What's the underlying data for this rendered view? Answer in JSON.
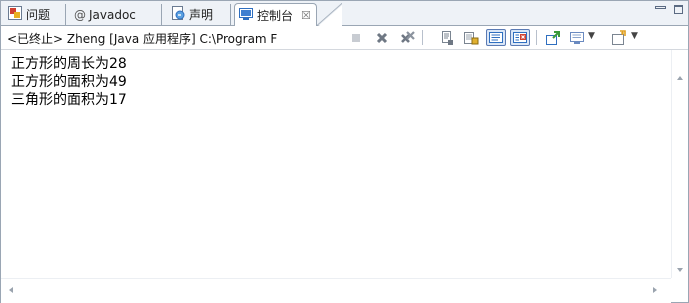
{
  "tabs": [
    {
      "label": "问题",
      "icon": "problems-icon"
    },
    {
      "label": "Javadoc",
      "icon": "at-sign-icon",
      "prefix": "@"
    },
    {
      "label": "声明",
      "icon": "declaration-icon"
    },
    {
      "label": "控制台",
      "icon": "console-icon",
      "active": true,
      "close": "☒"
    }
  ],
  "toolbar": {
    "description": "<已终止> Zheng [Java 应用程序] C:\\Program F",
    "buttons": [
      {
        "name": "terminate-icon"
      },
      {
        "name": "remove-launch-icon"
      },
      {
        "name": "remove-all-terminated-icon"
      },
      {
        "name": "clear-console-icon"
      },
      {
        "name": "scroll-lock-icon"
      },
      {
        "name": "show-on-stdout-icon"
      },
      {
        "name": "show-on-stderr-icon"
      },
      {
        "name": "pin-console-icon"
      },
      {
        "name": "display-console-icon"
      },
      {
        "name": "open-console-icon"
      }
    ]
  },
  "console": {
    "lines": [
      "正方形的周长为28",
      "正方形的面积为49",
      "三角形的面积为17"
    ]
  },
  "colors": {
    "tab_bg": "#eef2f7",
    "border": "#9aa6b4",
    "icon_blue": "#2f6fc0",
    "icon_gray": "#7b8591"
  }
}
